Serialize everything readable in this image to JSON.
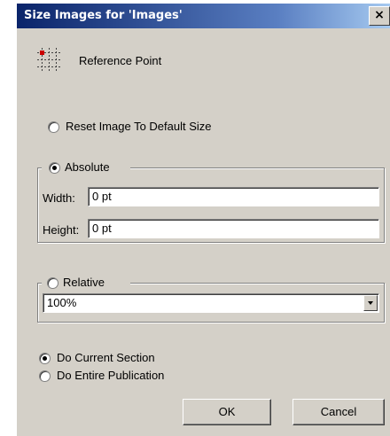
{
  "window": {
    "title": "Size Images for 'Images'",
    "close_label": "×"
  },
  "reference_point": {
    "label": "Reference Point",
    "icon": "reference-point-icon"
  },
  "options": {
    "reset_label": "Reset Image To Default Size",
    "reset_selected": false
  },
  "absolute": {
    "label": "Absolute",
    "selected": true,
    "width_label": "Width:",
    "width_value": "0 pt",
    "height_label": "Height:",
    "height_value": "0 pt"
  },
  "relative": {
    "label": "Relative",
    "selected": false,
    "value": "100%"
  },
  "scope": {
    "current_label": "Do Current Section",
    "current_selected": true,
    "entire_label": "Do Entire Publication",
    "entire_selected": false
  },
  "buttons": {
    "ok_label": "OK",
    "cancel_label": "Cancel"
  },
  "colors": {
    "dialog_face": "#d4d0c8",
    "title_start": "#0a246a",
    "title_end": "#a6caf0",
    "reference_point_marker": "#cc0000"
  }
}
